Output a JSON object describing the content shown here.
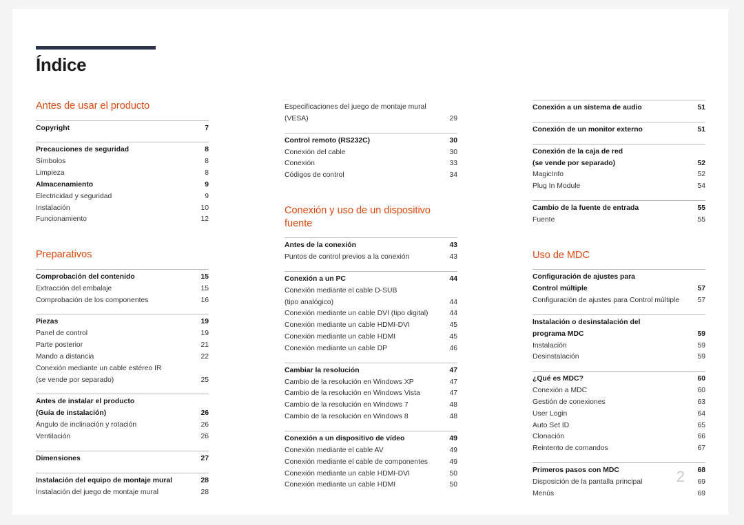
{
  "document": {
    "title": "Índice",
    "page_number": "2",
    "accent_color": "#e1480f",
    "rule_color": "#2d3349"
  },
  "columns": [
    {
      "name": "column-1",
      "blocks": [
        {
          "type": "section",
          "title": "Antes de usar el producto"
        },
        {
          "type": "group",
          "entries": [
            {
              "label": "Copyright",
              "page": "7",
              "level": "head"
            }
          ]
        },
        {
          "type": "group",
          "entries": [
            {
              "label": "Precauciones de seguridad",
              "page": "8",
              "level": "head"
            },
            {
              "label": "Símbolos",
              "page": "8",
              "level": "sub"
            },
            {
              "label": "Limpieza",
              "page": "8",
              "level": "sub"
            },
            {
              "label": "Almacenamiento",
              "page": "9",
              "level": "head"
            },
            {
              "label": "Electricidad y seguridad",
              "page": "9",
              "level": "sub"
            },
            {
              "label": "Instalación",
              "page": "10",
              "level": "sub"
            },
            {
              "label": "Funcionamiento",
              "page": "12",
              "level": "sub"
            }
          ]
        },
        {
          "type": "spacer-lg"
        },
        {
          "type": "section",
          "title": "Preparativos"
        },
        {
          "type": "group",
          "entries": [
            {
              "label": "Comprobación del contenido",
              "page": "15",
              "level": "head"
            },
            {
              "label": "Extracción del embalaje",
              "page": "15",
              "level": "sub"
            },
            {
              "label": "Comprobación de los componentes",
              "page": "16",
              "level": "sub"
            }
          ]
        },
        {
          "type": "group",
          "entries": [
            {
              "label": "Piezas",
              "page": "19",
              "level": "head"
            },
            {
              "label": "Panel de control",
              "page": "19",
              "level": "sub"
            },
            {
              "label": "Parte posterior",
              "page": "21",
              "level": "sub"
            },
            {
              "label": "Mando a distancia",
              "page": "22",
              "level": "sub"
            },
            {
              "label": "Conexión mediante un cable estéreo IR",
              "page": "",
              "level": "sub-nonum"
            },
            {
              "label": "(se vende por separado)",
              "page": "25",
              "level": "sub"
            }
          ]
        },
        {
          "type": "group",
          "entries": [
            {
              "label": "Antes de instalar el producto",
              "page": "",
              "level": "head-nonum"
            },
            {
              "label": "(Guía de instalación)",
              "page": "26",
              "level": "head"
            },
            {
              "label": "Ángulo de inclinación y rotación",
              "page": "26",
              "level": "sub"
            },
            {
              "label": "Ventilación",
              "page": "26",
              "level": "sub"
            }
          ]
        },
        {
          "type": "group",
          "entries": [
            {
              "label": "Dimensiones",
              "page": "27",
              "level": "head"
            }
          ]
        },
        {
          "type": "group",
          "entries": [
            {
              "label": "Instalación del equipo de montaje mural",
              "page": "28",
              "level": "head"
            },
            {
              "label": "Instalación del juego de montaje mural",
              "page": "28",
              "level": "sub"
            }
          ]
        }
      ]
    },
    {
      "name": "column-2",
      "blocks": [
        {
          "type": "group-noline",
          "entries": [
            {
              "label": "Especificaciones del juego de montaje mural",
              "page": "",
              "level": "sub-nonum"
            },
            {
              "label": "(VESA)",
              "page": "29",
              "level": "sub"
            }
          ]
        },
        {
          "type": "group",
          "entries": [
            {
              "label": "Control remoto (RS232C)",
              "page": "30",
              "level": "head"
            },
            {
              "label": "Conexión del cable",
              "page": "30",
              "level": "sub"
            },
            {
              "label": "Conexión",
              "page": "33",
              "level": "sub"
            },
            {
              "label": "Códigos de control",
              "page": "34",
              "level": "sub"
            }
          ]
        },
        {
          "type": "spacer-lg"
        },
        {
          "type": "section",
          "title": "Conexión y uso de un dispositivo fuente"
        },
        {
          "type": "group",
          "entries": [
            {
              "label": "Antes de la conexión",
              "page": "43",
              "level": "head"
            },
            {
              "label": "Puntos de control previos a la conexión",
              "page": "43",
              "level": "sub"
            }
          ]
        },
        {
          "type": "group",
          "entries": [
            {
              "label": "Conexión a un PC",
              "page": "44",
              "level": "head"
            },
            {
              "label": "Conexión mediante el cable D-SUB",
              "page": "",
              "level": "sub-nonum"
            },
            {
              "label": "(tipo analógico)",
              "page": "44",
              "level": "sub"
            },
            {
              "label": "Conexión mediante un cable DVI (tipo digital)",
              "page": "44",
              "level": "sub"
            },
            {
              "label": "Conexión mediante un cable HDMI-DVI",
              "page": "45",
              "level": "sub"
            },
            {
              "label": "Conexión mediante un cable HDMI",
              "page": "45",
              "level": "sub"
            },
            {
              "label": "Conexión mediante un cable DP",
              "page": "46",
              "level": "sub"
            }
          ]
        },
        {
          "type": "group",
          "entries": [
            {
              "label": "Cambiar la resolución",
              "page": "47",
              "level": "head"
            },
            {
              "label": "Cambio de la resolución en Windows XP",
              "page": "47",
              "level": "sub"
            },
            {
              "label": "Cambio de la resolución en Windows Vista",
              "page": "47",
              "level": "sub"
            },
            {
              "label": "Cambio de la resolución en Windows 7",
              "page": "48",
              "level": "sub"
            },
            {
              "label": "Cambio de la resolución en Windows 8",
              "page": "48",
              "level": "sub"
            }
          ]
        },
        {
          "type": "group",
          "entries": [
            {
              "label": "Conexión a un dispositivo de vídeo",
              "page": "49",
              "level": "head"
            },
            {
              "label": "Conexión mediante el cable AV",
              "page": "49",
              "level": "sub"
            },
            {
              "label": "Conexión mediante el cable de componentes",
              "page": "49",
              "level": "sub"
            },
            {
              "label": "Conexión mediante un cable HDMI-DVI",
              "page": "50",
              "level": "sub"
            },
            {
              "label": "Conexión mediante un cable HDMI",
              "page": "50",
              "level": "sub"
            }
          ]
        }
      ]
    },
    {
      "name": "column-3",
      "blocks": [
        {
          "type": "group",
          "entries": [
            {
              "label": "Conexión a un sistema de audio",
              "page": "51",
              "level": "head"
            }
          ]
        },
        {
          "type": "group",
          "entries": [
            {
              "label": "Conexión de un monitor externo",
              "page": "51",
              "level": "head"
            }
          ]
        },
        {
          "type": "group",
          "entries": [
            {
              "label": "Conexión de la caja de red",
              "page": "",
              "level": "head-nonum"
            },
            {
              "label": "(se vende por separado)",
              "page": "52",
              "level": "head"
            },
            {
              "label": "MagicInfo",
              "page": "52",
              "level": "sub"
            },
            {
              "label": "Plug In Module",
              "page": "54",
              "level": "sub"
            }
          ]
        },
        {
          "type": "group",
          "entries": [
            {
              "label": "Cambio de la fuente de entrada",
              "page": "55",
              "level": "head"
            },
            {
              "label": "Fuente",
              "page": "55",
              "level": "sub"
            }
          ]
        },
        {
          "type": "spacer-lg"
        },
        {
          "type": "section",
          "title": "Uso de MDC"
        },
        {
          "type": "group",
          "entries": [
            {
              "label": "Configuración de ajustes para",
              "page": "",
              "level": "head-nonum"
            },
            {
              "label": "Control múltiple",
              "page": "57",
              "level": "head"
            },
            {
              "label": "Configuración de ajustes para Control múltiple",
              "page": "57",
              "level": "sub"
            }
          ]
        },
        {
          "type": "group",
          "entries": [
            {
              "label": "Instalación o desinstalación del",
              "page": "",
              "level": "head-nonum"
            },
            {
              "label": "programa MDC",
              "page": "59",
              "level": "head"
            },
            {
              "label": "Instalación",
              "page": "59",
              "level": "sub"
            },
            {
              "label": "Desinstalación",
              "page": "59",
              "level": "sub"
            }
          ]
        },
        {
          "type": "group",
          "entries": [
            {
              "label": "¿Qué es MDC?",
              "page": "60",
              "level": "head"
            },
            {
              "label": "Conexión a MDC",
              "page": "60",
              "level": "sub"
            },
            {
              "label": "Gestión de conexiones",
              "page": "63",
              "level": "sub"
            },
            {
              "label": "User Login",
              "page": "64",
              "level": "sub"
            },
            {
              "label": "Auto Set ID",
              "page": "65",
              "level": "sub"
            },
            {
              "label": "Clonación",
              "page": "66",
              "level": "sub"
            },
            {
              "label": "Reintento de comandos",
              "page": "67",
              "level": "sub"
            }
          ]
        },
        {
          "type": "group",
          "entries": [
            {
              "label": "Primeros pasos con MDC",
              "page": "68",
              "level": "head"
            },
            {
              "label": "Disposición de la pantalla principal",
              "page": "69",
              "level": "sub"
            },
            {
              "label": "Menús",
              "page": "69",
              "level": "sub"
            }
          ]
        }
      ]
    }
  ]
}
